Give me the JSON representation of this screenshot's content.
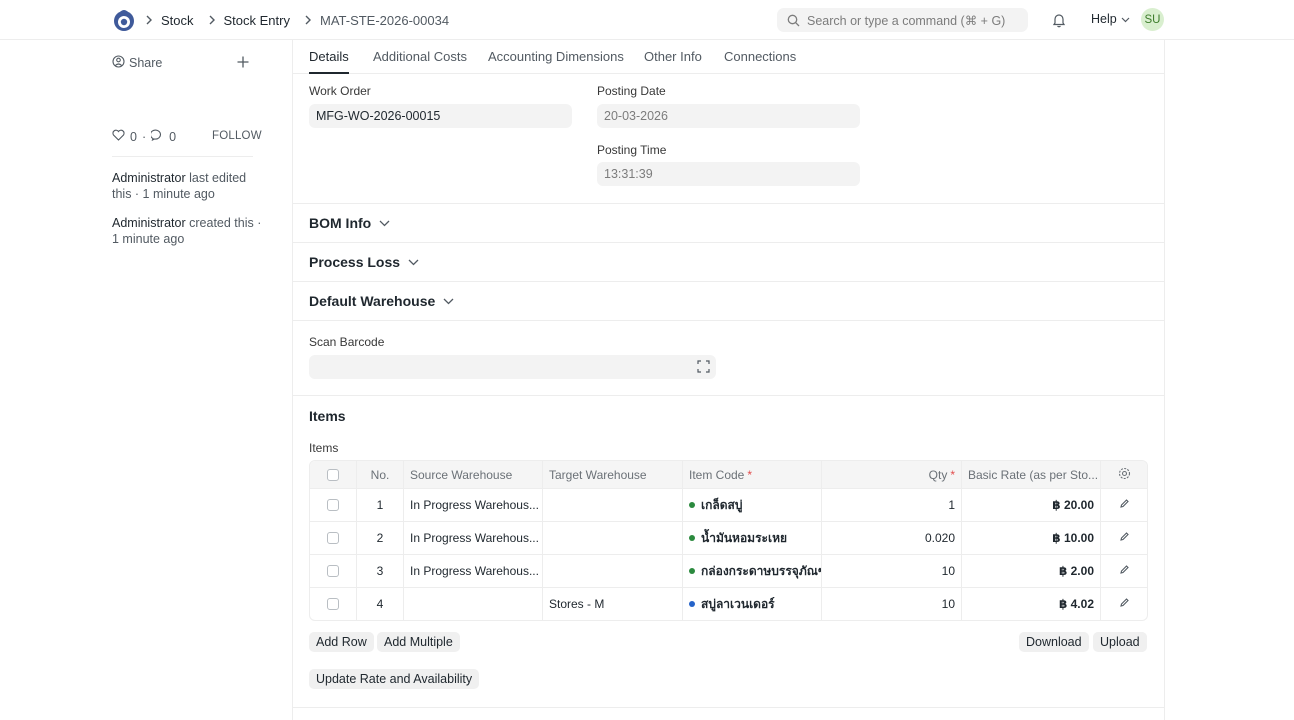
{
  "breadcrumbs": [
    "Stock",
    "Stock Entry",
    "MAT-STE-2026-00034"
  ],
  "search": {
    "placeholder": "Search or type a command (⌘ + G)"
  },
  "navbar": {
    "help": "Help",
    "avatar": "SU"
  },
  "sidebar": {
    "share": "Share",
    "likes": "0",
    "comments": "0",
    "follow": "FOLLOW",
    "activity": [
      {
        "user": "Administrator",
        "text": "last edited this · 1 minute ago"
      },
      {
        "user": "Administrator",
        "text": "created this · 1 minute ago"
      }
    ]
  },
  "tabs": [
    "Details",
    "Additional Costs",
    "Accounting Dimensions",
    "Other Info",
    "Connections"
  ],
  "fields": {
    "work_order": {
      "label": "Work Order",
      "value": "MFG-WO-2026-00015"
    },
    "posting_date": {
      "label": "Posting Date",
      "value": "20-03-2026"
    },
    "posting_time": {
      "label": "Posting Time",
      "value": "13:31:39"
    },
    "scan_barcode": {
      "label": "Scan Barcode",
      "value": ""
    }
  },
  "sections": {
    "bom_info": "BOM Info",
    "process_loss": "Process Loss",
    "default_warehouse": "Default Warehouse",
    "items": "Items"
  },
  "items_table": {
    "label": "Items",
    "columns": {
      "no": "No.",
      "source": "Source Warehouse",
      "target": "Target Warehouse",
      "item_code": "Item Code",
      "qty": "Qty",
      "rate": "Basic Rate (as per Sto..."
    },
    "rows": [
      {
        "no": "1",
        "source": "In Progress Warehous...",
        "target": "",
        "item_code": "เกล็ดสบู่",
        "qty": "1",
        "rate": "฿ 20.00",
        "dot": "#2b8a3e"
      },
      {
        "no": "2",
        "source": "In Progress Warehous...",
        "target": "",
        "item_code": "น้ำมันหอมระเหย",
        "qty": "0.020",
        "rate": "฿ 10.00",
        "dot": "#2b8a3e"
      },
      {
        "no": "3",
        "source": "In Progress Warehous...",
        "target": "",
        "item_code": "กล่องกระดาษบรรจุภัณฑ์",
        "qty": "10",
        "rate": "฿ 2.00",
        "dot": "#2b8a3e"
      },
      {
        "no": "4",
        "source": "",
        "target": "Stores - M",
        "item_code": "สบู่ลาเวนเดอร์",
        "qty": "10",
        "rate": "฿ 4.02",
        "dot": "#2563c9"
      }
    ]
  },
  "buttons": {
    "add_row": "Add Row",
    "add_multiple": "Add Multiple",
    "download": "Download",
    "upload": "Upload",
    "update_rate": "Update Rate and Availability"
  }
}
